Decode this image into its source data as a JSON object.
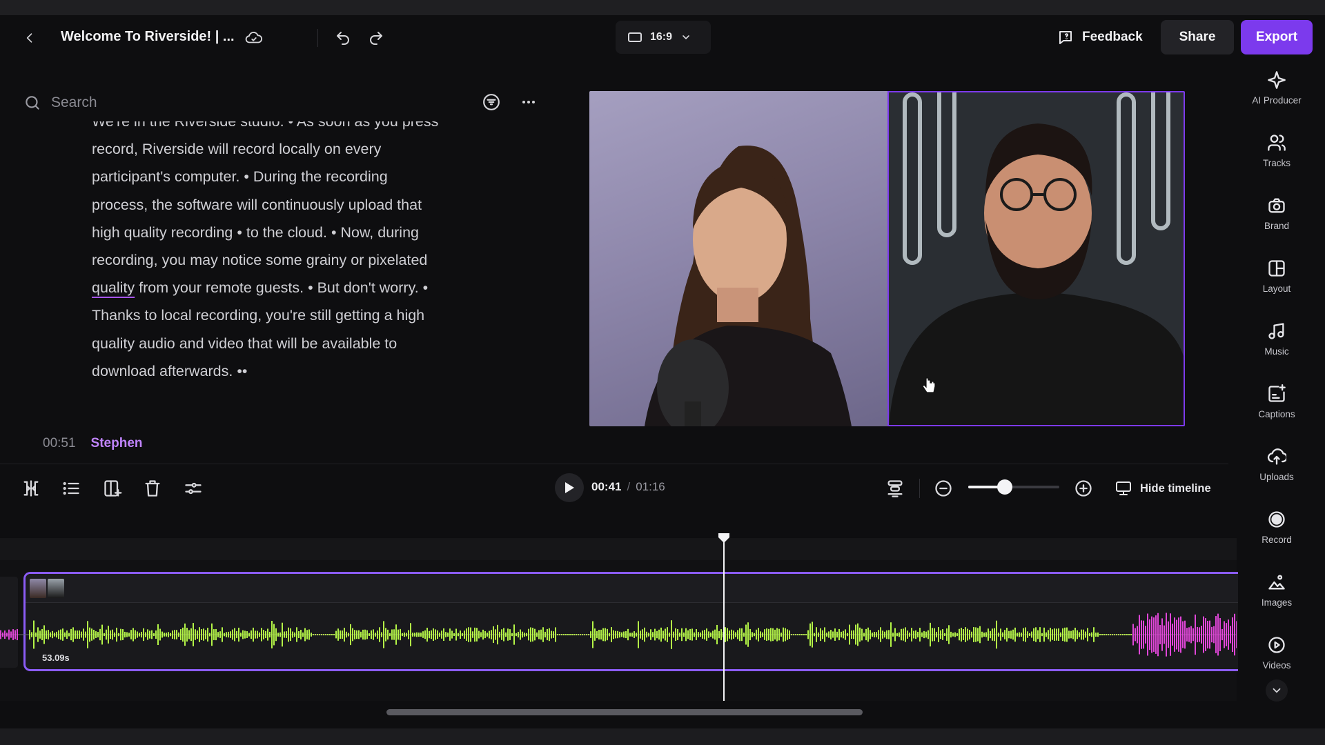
{
  "header": {
    "back_icon": "chevron-left-icon",
    "title": "Welcome To Riverside! | ...",
    "cloud_icon": "cloud-sync-icon",
    "undo_icon": "undo-icon",
    "redo_icon": "redo-icon",
    "aspect_ratio": "16:9",
    "feedback_label": "Feedback",
    "share_label": "Share",
    "export_label": "Export",
    "accent_color": "#7c3aed"
  },
  "search": {
    "placeholder": "Search",
    "filter_icon": "filter-icon",
    "more_icon": "more-horizontal-icon"
  },
  "transcript": {
    "lines": [
      "We're in the Riverside studio. • As soon as you press",
      "record, Riverside will record locally on every",
      "participant's computer. • During the recording",
      "process, the software will continuously upload that",
      "high quality recording • to the cloud. • Now, during",
      "recording, you may notice some grainy or pixelated",
      "from your remote guests. • But don't worry. •",
      "Thanks to local recording, you're still getting a high",
      "quality audio and video that will be available to",
      "download afterwards. ••"
    ],
    "underlined_word": "quality",
    "next_speaker_time": "00:51",
    "next_speaker_name": "Stephen"
  },
  "rail": {
    "items": [
      {
        "label": "AI Producer",
        "icon": "sparkle-icon"
      },
      {
        "label": "Tracks",
        "icon": "users-icon"
      },
      {
        "label": "Brand",
        "icon": "brand-kit-icon"
      },
      {
        "label": "Layout",
        "icon": "layout-icon"
      },
      {
        "label": "Music",
        "icon": "music-note-icon"
      },
      {
        "label": "Captions",
        "icon": "captions-icon"
      },
      {
        "label": "Uploads",
        "icon": "upload-cloud-icon"
      },
      {
        "label": "Record",
        "icon": "record-icon"
      },
      {
        "label": "Images",
        "icon": "image-icon"
      },
      {
        "label": "Videos",
        "icon": "video-play-icon"
      }
    ],
    "more_icon": "chevron-down-icon"
  },
  "toolbar": {
    "split_icon": "split-icon",
    "list_icon": "list-icon",
    "add_clip_icon": "add-layout-icon",
    "delete_icon": "trash-icon",
    "adjust_icon": "adjust-icon",
    "current_time": "00:41",
    "separator": "/",
    "total_time": "01:16",
    "align_icon": "align-icon",
    "zoom_level": 0.4,
    "hide_timeline_label": "Hide timeline"
  },
  "timeline": {
    "clip_duration": "53.09s",
    "playhead_time": "00:41",
    "wave_color_main": "#b4f547",
    "wave_color_other": "#e046d8"
  }
}
